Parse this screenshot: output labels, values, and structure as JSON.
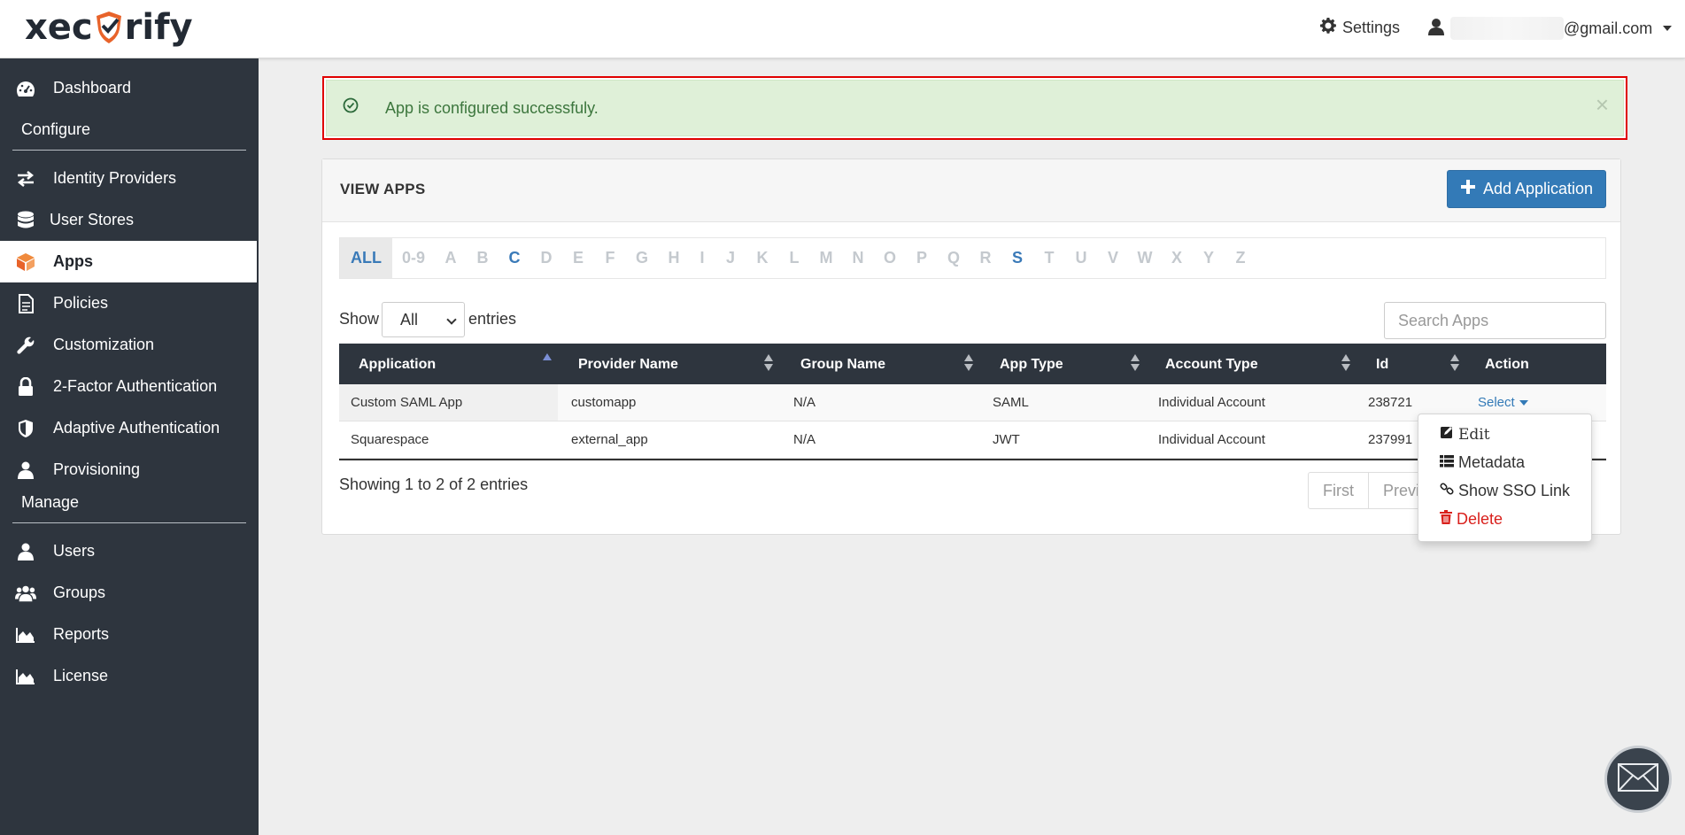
{
  "header": {
    "logo_text_left": "xec",
    "logo_text_right": "rify",
    "settings_label": "Settings",
    "user_email_suffix": "@gmail.com"
  },
  "sidebar": {
    "items": [
      {
        "label": "Dashboard",
        "icon": "dashboard-icon"
      },
      {
        "label": "Identity Providers",
        "icon": "exchange-icon"
      },
      {
        "label": "User Stores",
        "icon": "database-icon"
      },
      {
        "label": "Apps",
        "icon": "cube-icon",
        "active": true
      },
      {
        "label": "Policies",
        "icon": "document-icon"
      },
      {
        "label": "Customization",
        "icon": "wrench-icon"
      },
      {
        "label": "2-Factor Authentication",
        "icon": "lock-icon"
      },
      {
        "label": "Adaptive Authentication",
        "icon": "shield-icon"
      },
      {
        "label": "Provisioning",
        "icon": "user-icon"
      },
      {
        "label": "Users",
        "icon": "user-icon"
      },
      {
        "label": "Groups",
        "icon": "users-icon"
      },
      {
        "label": "Reports",
        "icon": "area-chart-icon"
      },
      {
        "label": "License",
        "icon": "area-chart-icon"
      }
    ],
    "sections": {
      "configure": "Configure",
      "manage": "Manage"
    }
  },
  "alert": {
    "message": "App is configured successfuly.",
    "close": "×",
    "color": "#dff0d8"
  },
  "panel": {
    "title": "VIEW APPS",
    "add_button": "Add Application",
    "accent": "#337ab7"
  },
  "alphabet": [
    "ALL",
    "0-9",
    "A",
    "B",
    "C",
    "D",
    "E",
    "F",
    "G",
    "H",
    "I",
    "J",
    "K",
    "L",
    "M",
    "N",
    "O",
    "P",
    "Q",
    "R",
    "S",
    "T",
    "U",
    "V",
    "W",
    "X",
    "Y",
    "Z"
  ],
  "alphabet_active": [
    "ALL",
    "C",
    "S"
  ],
  "list_controls": {
    "show_label": "Show",
    "show_value": "All",
    "entries_label": "entries",
    "search_placeholder": "Search Apps"
  },
  "table": {
    "columns": [
      "Application",
      "Provider Name",
      "Group Name",
      "App Type",
      "Account Type",
      "Id",
      "Action"
    ],
    "rows": [
      [
        "Custom SAML App",
        "customapp",
        "N/A",
        "SAML",
        "Individual Account",
        "238721",
        "Select"
      ],
      [
        "Squarespace",
        "external_app",
        "N/A",
        "JWT",
        "Individual Account",
        "237991",
        ""
      ]
    ]
  },
  "footer": {
    "showing": "Showing 1 to 2 of 2 entries",
    "pager": [
      "First",
      "Previo"
    ]
  },
  "action_menu": {
    "items": [
      {
        "label": "Edit",
        "icon": "edit-icon"
      },
      {
        "label": "Metadata",
        "icon": "list-icon"
      },
      {
        "label": "Show SSO Link",
        "icon": "link-icon"
      },
      {
        "label": "Delete",
        "icon": "trash-icon"
      }
    ]
  }
}
